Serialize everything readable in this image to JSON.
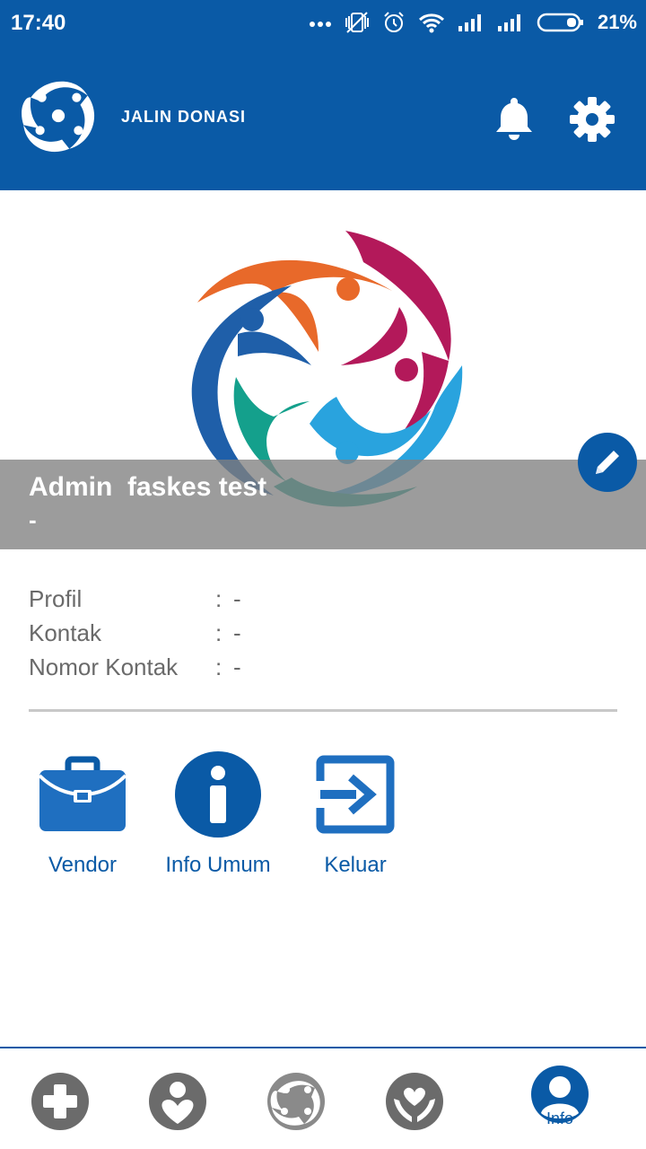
{
  "status_bar": {
    "time": "17:40",
    "battery": "21%",
    "icons": [
      "more-dots-icon",
      "vibrate-off-icon",
      "alarm-icon",
      "wifi-icon",
      "signal-icon",
      "signal-icon",
      "battery-icon"
    ]
  },
  "app_bar": {
    "title": "JALIN DONASI",
    "icons": [
      "bell-icon",
      "gear-icon"
    ]
  },
  "profile": {
    "name": "Admin  faskes test",
    "subtitle": "-"
  },
  "info": {
    "rows": [
      {
        "label": "Profil",
        "sep": ":",
        "value": "-"
      },
      {
        "label": "Kontak",
        "sep": ":",
        "value": "-"
      },
      {
        "label": "Nomor Kontak",
        "sep": ":",
        "value": "-"
      }
    ]
  },
  "actions": [
    {
      "label": "Vendor",
      "icon": "briefcase-icon"
    },
    {
      "label": "Info Umum",
      "icon": "info-icon"
    },
    {
      "label": "Keluar",
      "icon": "logout-icon"
    }
  ],
  "bottom_nav": {
    "items": [
      {
        "icon": "medical-cross-icon"
      },
      {
        "icon": "person-heart-icon"
      },
      {
        "icon": "donation-logo-icon"
      },
      {
        "icon": "hands-heart-icon"
      },
      {
        "icon": "user-icon",
        "label": "Info"
      }
    ]
  },
  "colors": {
    "primary": "#0a5aa6",
    "orange": "#e8692a",
    "magenta": "#b3195a",
    "light_blue": "#29a3de",
    "teal": "#14a08c",
    "navy": "#1f5fa9",
    "inactive": "#6b6b6b"
  }
}
